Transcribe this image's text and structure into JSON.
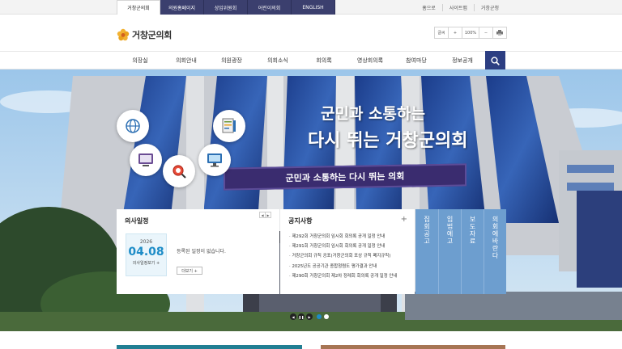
{
  "topbar": {
    "site_tabs": [
      {
        "label": "거창군의회",
        "active": true
      },
      {
        "label": "의원홈페이지",
        "active": false
      },
      {
        "label": "상임위원회",
        "active": false
      },
      {
        "label": "어린이의회",
        "active": false
      },
      {
        "label": "ENGLISH",
        "active": false
      }
    ],
    "util_links": [
      "홈으로",
      "사이트맵",
      "거창군청"
    ]
  },
  "header": {
    "logo_text": "거창군의회",
    "logo_icon": "county-flower-emblem",
    "zoom": {
      "label": "글씨",
      "plus": "+",
      "value": "100%",
      "minus": "−",
      "print_icon": "printer-icon"
    }
  },
  "nav": {
    "items": [
      "의장실",
      "의회안내",
      "의원광장",
      "의회소식",
      "회의록",
      "영상회의록",
      "참여마당",
      "정보공개"
    ],
    "search_icon": "search-icon",
    "search_color": "#2c3e82"
  },
  "hero": {
    "title_line1": "군민과 소통하는",
    "title_line2": "다시 뛰는 거창군의회",
    "banner_text": "군민과 소통하는 다시 뛰는 의회",
    "icons": [
      "globe-icon",
      "tablet-icon",
      "monitor-doc-icon",
      "search-magnifier-icon",
      "computer-icon"
    ]
  },
  "schedule": {
    "title": "의사일정",
    "prev": "◀",
    "next": "▶",
    "year": "2026",
    "date": "04.08",
    "detail_link": "의사일정보기 +",
    "message": "등록된 일정이 없습니다.",
    "more_label": "더보기 +"
  },
  "notice": {
    "title": "공지사항",
    "plus": "+",
    "items": [
      "제292회 거창군의회 임시회 회의록 공개 일정 안내",
      "제291회 거창군의회 임시회 회의록 공개 일정 안내",
      "거창군의회 규칙 공포(거창군의회 포상 규칙 폐지규칙)",
      "2025년도 공공기관 종합청렴도 평가결과 안내",
      "제290회 거창군의회 제2차 정례회 회의록 공개 일정 안내"
    ]
  },
  "quick_links": [
    {
      "label": "집회공고",
      "color": "#6d9ecf"
    },
    {
      "label": "입법예고",
      "color": "#6d9ecf"
    },
    {
      "label": "보도자료",
      "color": "#6d9ecf"
    },
    {
      "label": "의회에바란다",
      "color": "#6d9ecf"
    }
  ],
  "slider": {
    "prev": "◀",
    "pause": "❚❚",
    "next": "▶",
    "dots": 2,
    "active_dot": 0
  },
  "colors": {
    "nav_accent": "#2c3e82",
    "date_accent": "#1d8cc7",
    "bar1": "#217f93",
    "bar2": "#a77554",
    "tab_bg": "#3b3f6e"
  }
}
